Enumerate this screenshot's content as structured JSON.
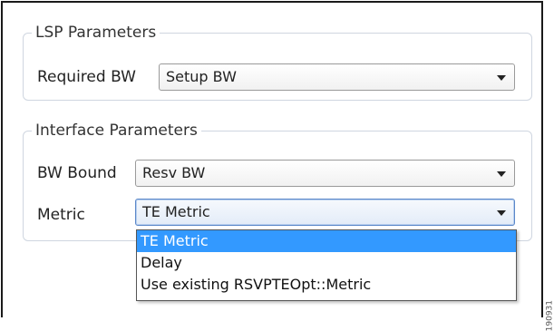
{
  "lsp_group": {
    "title": "LSP Parameters",
    "required_bw": {
      "label": "Required BW",
      "value": "Setup BW"
    }
  },
  "interface_group": {
    "title": "Interface Parameters",
    "bw_bound": {
      "label": "BW Bound",
      "value": "Resv BW"
    },
    "metric": {
      "label": "Metric",
      "value": "TE Metric"
    }
  },
  "metric_dropdown": {
    "options": [
      "TE Metric",
      "Delay",
      "Use existing RSVPTEOpt::Metric"
    ],
    "selected": "TE Metric"
  },
  "figure_id": "190931",
  "colors": {
    "selection": "#3399ff",
    "focus_border": "#5b87c9",
    "group_border": "#cfd6e0"
  }
}
